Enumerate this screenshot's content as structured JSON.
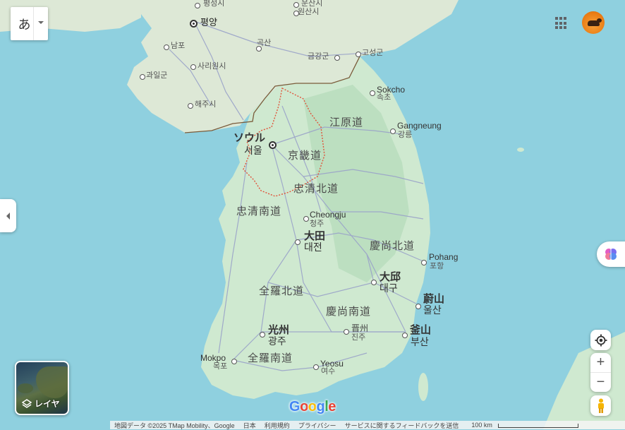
{
  "controls": {
    "language_char": "あ",
    "layer_label": "レイヤ",
    "zoom_in": "+",
    "zoom_out": "−"
  },
  "places": {
    "pyongsong": "평성시",
    "unsan": "운산시",
    "wonsan": "원산시",
    "pyongyang": "평양",
    "nampo": "남포",
    "goksan": "곡산",
    "gumgang": "금강군",
    "goseong": "고성군",
    "gwail": "과일군",
    "sariwon": "사리원시",
    "haeju": "해주시",
    "sokcho_en": "Sokcho",
    "sokcho_ko": "속초",
    "gangwon_prov": "江原道",
    "gangneung_en": "Gangneung",
    "gangneung_ko": "강릉",
    "seoul_ja": "ソウル",
    "seoul_ko": "서울",
    "gyeonggi_prov": "京畿道",
    "chungbuk_prov": "忠清北道",
    "chungnam_prov": "忠清南道",
    "cheongju_en": "Cheongju",
    "cheongju_ko": "청주",
    "daejeon_ja": "大田",
    "daejeon_ko": "대전",
    "gyeongbuk_prov": "慶尚北道",
    "pohang_en": "Pohang",
    "pohang_ko": "포항",
    "daegu_ja": "大邱",
    "daegu_ko": "대구",
    "jeonbuk_prov": "全羅北道",
    "ulsan_ja": "蔚山",
    "ulsan_ko": "울산",
    "gyeongnam_prov": "慶尚南道",
    "gwangju_ja": "光州",
    "gwangju_ko": "광주",
    "jinju_ja": "晋州",
    "jinju_ko": "진주",
    "busan_ja": "釜山",
    "busan_ko": "부산",
    "mokpo_en": "Mokpo",
    "mokpo_ko": "목포",
    "jeonnam_prov": "全羅南道",
    "yeosu_en": "Yeosu",
    "yeosu_ko": "여수"
  },
  "footer": {
    "attribution": "地図データ ©2025 TMap Mobility、Google",
    "country": "日本",
    "terms": "利用規約",
    "privacy": "プライバシー",
    "feedback": "サービスに関するフィードバックを送信",
    "scale": "100 km"
  },
  "logo": [
    "G",
    "o",
    "o",
    "g",
    "l",
    "e"
  ],
  "colors": {
    "water": "#8fd0df",
    "land": "#cfe9d0",
    "north_land": "#dde8d6",
    "road": "#9aa3c9",
    "border": "#c6513a"
  }
}
